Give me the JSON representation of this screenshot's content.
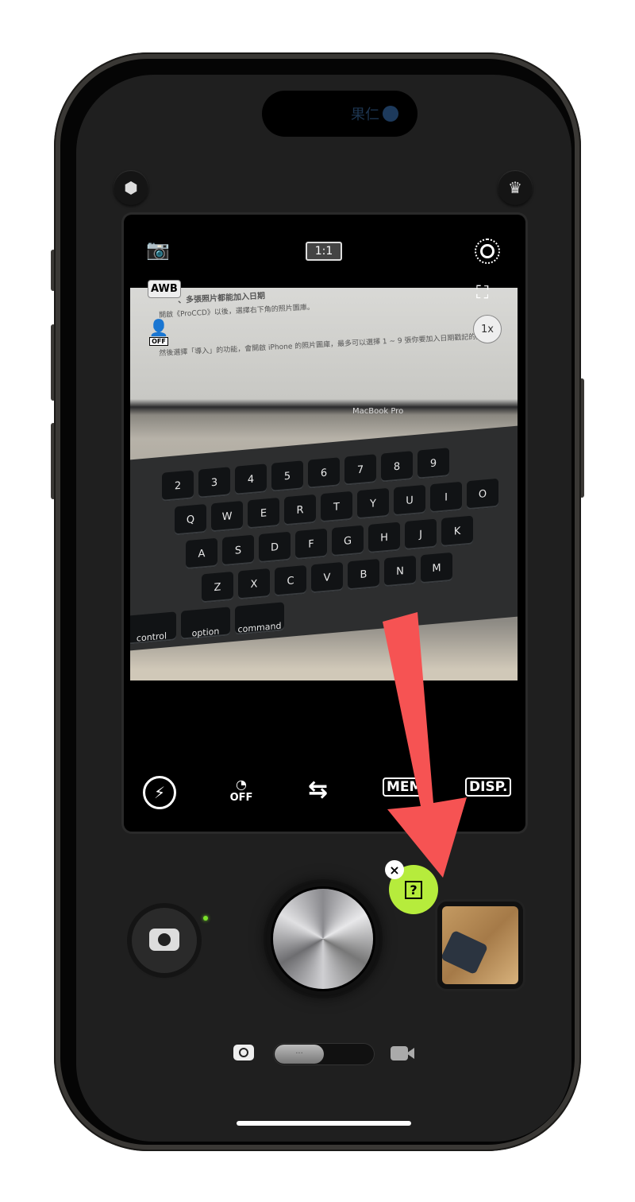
{
  "status_bar": {
    "watermark": "果仁"
  },
  "top_buttons": {
    "settings_icon": "hexagon-nut-icon",
    "premium_icon": "crown-icon"
  },
  "viewfinder": {
    "top": {
      "camera_icon": "camera-icon",
      "aspect_ratio": "1:1",
      "grid_icon": "dotted-target-icon"
    },
    "left": {
      "white_balance": "AWB",
      "face_mode": "OFF"
    },
    "right": {
      "crop_icon": "crop-icon",
      "zoom": "1x"
    },
    "photo": {
      "screen_lines": [
        "、多張照片都能加入日期",
        "開啟《ProCCD》以後，選擇右下角的照片圖庫。",
        "然後選擇「導入」的功能，會開啟 iPhone 的照片圖庫，最多可以選擇 1 ~ 9 張你要加入日期戳記的照片。"
      ],
      "laptop_label": "MacBook Pro",
      "key_rows": [
        [
          "2",
          "3",
          "4",
          "5",
          "6",
          "7",
          "8",
          "9"
        ],
        [
          "Q",
          "W",
          "E",
          "R",
          "T",
          "Y",
          "U",
          "I",
          "O"
        ],
        [
          "A",
          "S",
          "D",
          "F",
          "G",
          "H",
          "J",
          "K"
        ],
        [
          "Z",
          "X",
          "C",
          "V",
          "B",
          "N",
          "M"
        ],
        [
          "control",
          "option",
          "command"
        ]
      ]
    },
    "bottom": {
      "flash": "flash-off-icon",
      "timer_label": "OFF",
      "flip_icon": "swap-arrows-icon",
      "memory_label": "MEM",
      "display_label": "DISP."
    }
  },
  "controls": {
    "selfie_icon": "camera-icon",
    "shutter": "shutter-button",
    "help_icon": "book-question-icon",
    "close_label": "×",
    "gallery": "photo-thumbnail",
    "mode": {
      "photo_icon": "camera-icon",
      "video_icon": "video-camera-icon",
      "selected": "photo",
      "knob_label": "···"
    }
  },
  "annotation": {
    "arrow_color": "#f65353",
    "help_color": "#b6ec3c",
    "led_color": "#7be22a"
  }
}
